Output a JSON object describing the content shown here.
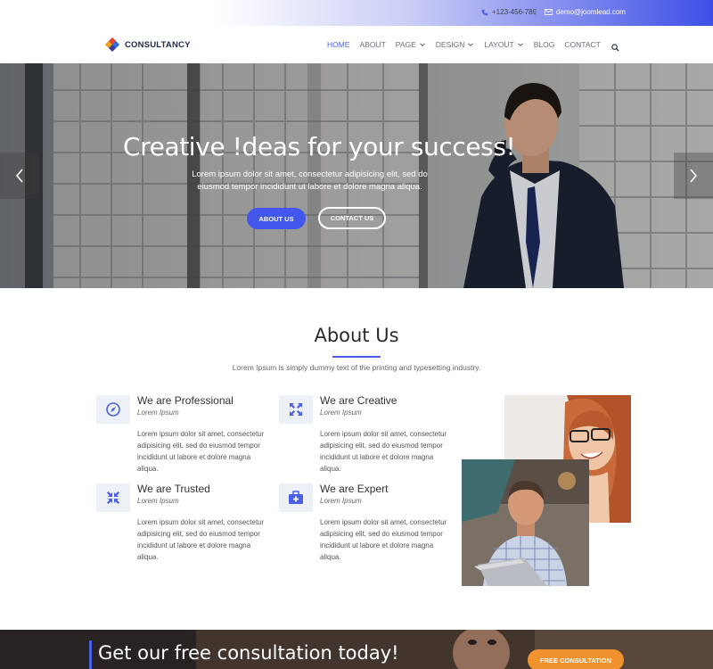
{
  "topbar": {
    "phone": "+123-456-789",
    "email": "demo@joomlead.com",
    "phone_icon": "phone-icon",
    "email_icon": "envelope-icon"
  },
  "brand": {
    "name": "CONSULTANCY",
    "colors": [
      "#e8452c",
      "#2f6fe0",
      "#f2a51a",
      "#3a3f9e"
    ]
  },
  "nav": {
    "items": [
      {
        "label": "HOME",
        "active": true
      },
      {
        "label": "ABOUT"
      },
      {
        "label": "PAGE",
        "dropdown": true
      },
      {
        "label": "DESIGN",
        "dropdown": true
      },
      {
        "label": "LAYOUT",
        "dropdown": true
      },
      {
        "label": "BLOG"
      },
      {
        "label": "CONTACT"
      }
    ],
    "search_icon": "search-icon"
  },
  "hero": {
    "title": "Creative !deas for your success!",
    "subtitle": "Lorem ipsum dolor sit amet, consectetur adipisicing elit, sed do eiusmod tempor incididunt ut labore et dolore magna aliqua.",
    "primary_button": "ABOUT US",
    "secondary_button": "CONTACT US",
    "prev_icon": "chevron-left-icon",
    "next_icon": "chevron-right-icon"
  },
  "about": {
    "title": "About Us",
    "subtitle": "Lorem Ipsum is simply dummy text of the printing and typesetting industry.",
    "features": [
      {
        "title": "We are Professional",
        "tag": "Lorem Ipsum",
        "body": "Lorem ipsum dolor sit amet, consectetur adipisicing elit, sed do eiusmod tempor incididunt ut labore et dolore magna aliqua.",
        "icon": "compass-icon"
      },
      {
        "title": "We are Creative",
        "tag": "Lorem Ipsum",
        "body": "Lorem ipsum dolor sit amet, consectetur adipisicing elit, sed do eiusmod tempor incididunt ut labore et dolore magna aliqua.",
        "icon": "expand-arrows-icon"
      },
      {
        "title": "We are Trusted",
        "tag": "Lorem Ipsum",
        "body": "Lorem ipsum dolor sit amet, consectetur adipisicing elit, sed do eiusmod tempor incididunt ut labore et dolore magna aliqua.",
        "icon": "compress-arrows-icon"
      },
      {
        "title": "We are Expert",
        "tag": "Lorem Ipsum",
        "body": "Lorem ipsum dolor sit amet, consectetur adipisicing elit, sed do eiusmod tempor incididunt ut labore et dolore magna aliqua.",
        "icon": "medical-kit-icon"
      }
    ]
  },
  "cta": {
    "text": "Get our free consultation today!",
    "button": "FREE CONSULTATION"
  },
  "colors": {
    "accent": "#4a5fe8",
    "cta_button": "#f0922e"
  }
}
